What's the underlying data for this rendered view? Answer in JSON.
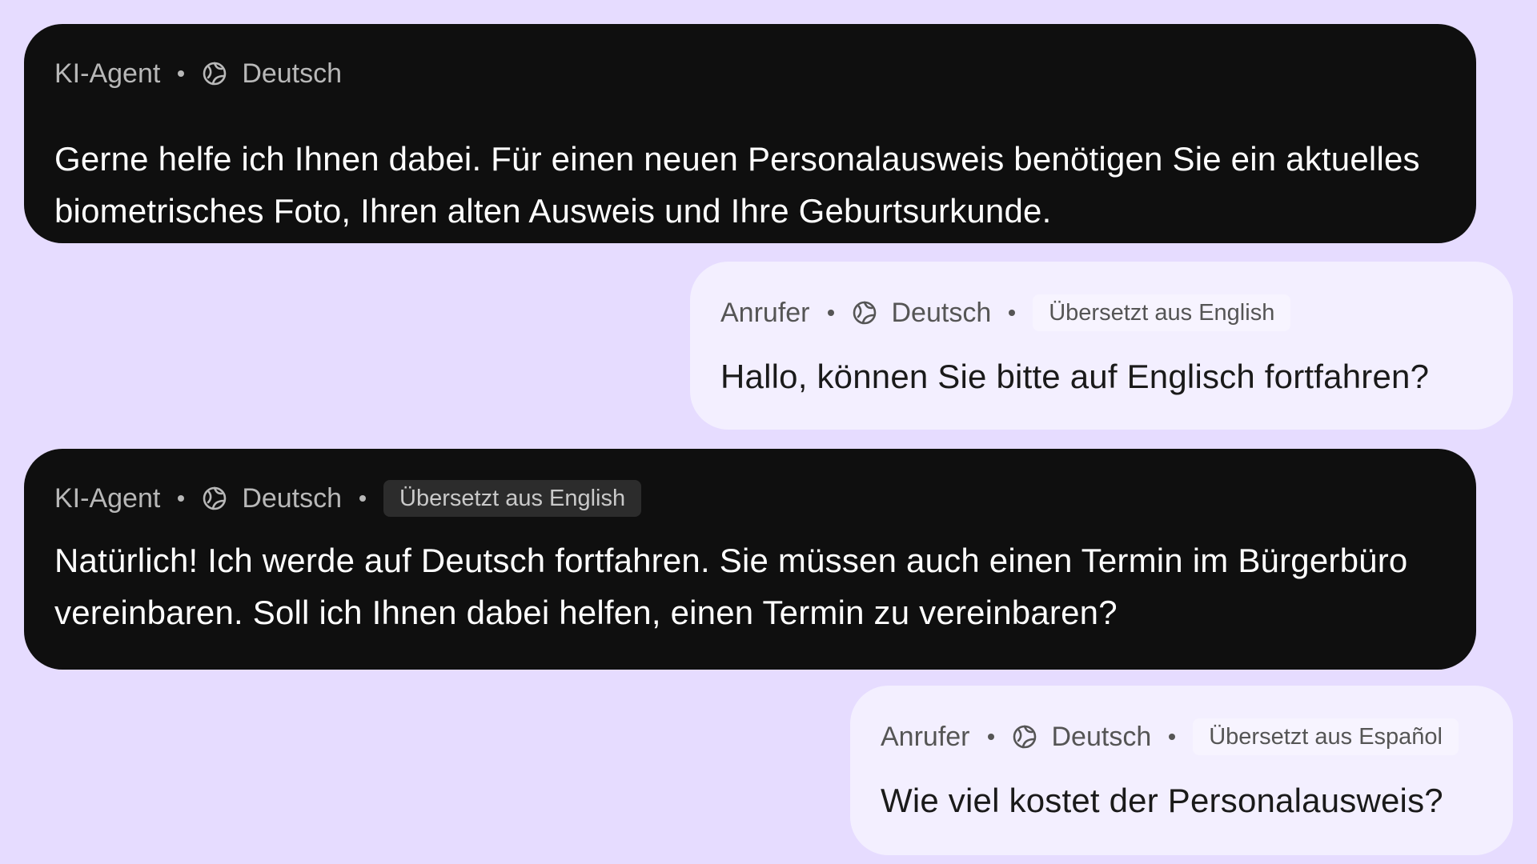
{
  "messages": [
    {
      "role": "agent",
      "speaker": "KI-Agent",
      "language": "Deutsch",
      "badge": "",
      "text": "Gerne helfe ich Ihnen dabei. Für einen neuen Personalausweis benötigen Sie ein aktuelles biometrisches Foto, Ihren alten Ausweis und Ihre Geburtsurkunde."
    },
    {
      "role": "caller",
      "speaker": "Anrufer",
      "language": "Deutsch",
      "badge": "Übersetzt aus English",
      "text": "Hallo, können Sie bitte auf Englisch fortfahren?"
    },
    {
      "role": "agent",
      "speaker": "KI-Agent",
      "language": "Deutsch",
      "badge": "Übersetzt aus English",
      "text": "Natürlich! Ich werde auf Deutsch fortfahren. Sie müssen auch einen Termin im Bürgerbüro vereinbaren. Soll ich Ihnen dabei helfen, einen Termin zu vereinbaren?"
    },
    {
      "role": "caller",
      "speaker": "Anrufer",
      "language": "Deutsch",
      "badge": "Übersetzt aus Español",
      "text": "Wie viel kostet der Personalausweis?"
    }
  ],
  "icons": {
    "language": "globe-icon"
  },
  "colors": {
    "background": "#E6DCFF",
    "agent_bubble": "#0F0F0F",
    "caller_bubble": "#F3EFFF"
  }
}
